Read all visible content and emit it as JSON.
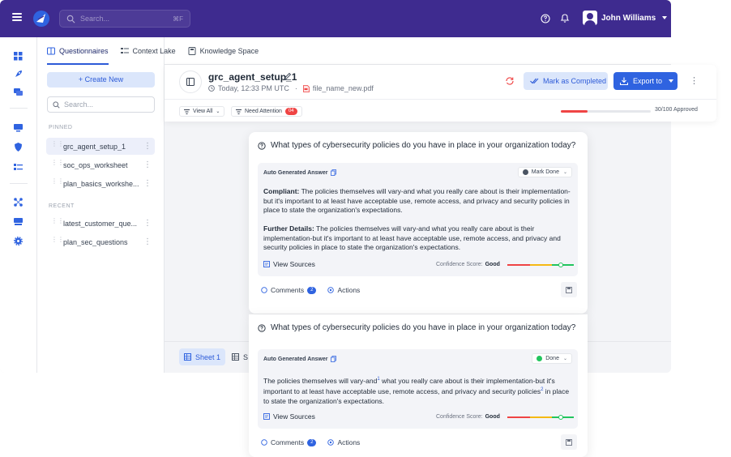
{
  "topbar": {
    "search_placeholder": "Search...",
    "search_shortcut": "⌘F",
    "user_name": "John Williams",
    "icons": [
      "menu-icon",
      "logo-icon",
      "search-icon",
      "help-icon",
      "bell-icon",
      "avatar",
      "chevron-down-icon"
    ]
  },
  "rail": {
    "icons": [
      "dashboard-icon",
      "rocket-icon",
      "chat-icon",
      "monitor-icon",
      "shield-icon",
      "list-icon",
      "nodes-icon",
      "display-icon",
      "gear-icon"
    ]
  },
  "sidebar": {
    "create_label": "+ Create New",
    "search_placeholder": "Search...",
    "pinned_label": "PINNED",
    "pinned": [
      {
        "label": "grc_agent_setup_1",
        "active": true
      },
      {
        "label": "soc_ops_worksheet",
        "active": false
      },
      {
        "label": "plan_basics_workshe...",
        "active": false
      }
    ],
    "recent_label": "RECENT",
    "recent": [
      {
        "label": "latest_customer_que..."
      },
      {
        "label": "plan_sec_questions"
      }
    ]
  },
  "tabs": [
    {
      "label": "Questionnaires",
      "active": true
    },
    {
      "label": "Context Lake",
      "active": false
    },
    {
      "label": "Knowledge Space",
      "active": false
    }
  ],
  "header": {
    "title": "grc_agent_setup_1",
    "timestamp": "Today, 12:33 PM UTC",
    "file": "file_name_new.pdf",
    "mark_label": "Mark as Completed",
    "export_label": "Export to",
    "view_all": "View All",
    "need_attention": "Need Attention",
    "need_attention_count": "04",
    "progress_fraction": 0.3,
    "progress_text": "30/100 Approved"
  },
  "sheets": [
    {
      "label": "Sheet 1",
      "active": true
    },
    {
      "label": "S",
      "active": false
    }
  ],
  "questions": [
    {
      "question": "What types of cybersecurity policies do you have in place in your organization today?",
      "answer_label": "Auto Generated Answer",
      "status": "Mark Done",
      "compliant_label": "Compliant:",
      "compliant_text": "The policies themselves will vary-and   what you really care about is their implementation-but it's important to at least have acceptable use, remote access, and privacy and security policies in place to state the organization's expectations.",
      "details_label": "Further Details:",
      "details_text": "The policies themselves will vary-and   what you really care about is their implementation-but it's important to at least have acceptable use, remote access, and privacy and security policies   in place to state the organization's expectations.",
      "view_sources": "View Sources",
      "confidence_label": "Confidence Score:",
      "confidence_value": "Good",
      "comments_label": "Comments",
      "comments_count": "2",
      "actions_label": "Actions"
    },
    {
      "question": "What types of cybersecurity policies do you have in place in your organization today?",
      "answer_label": "Auto Generated Answer",
      "status": "Done",
      "text_1": "The policies themselves will vary-and",
      "sup_1": "1",
      "text_2": " what you really care about is their implementation-but it's important to at least have acceptable use, remote access, and privacy and security policies",
      "sup_2": "2",
      "text_3": " in place to state the organization's expectations.",
      "view_sources": "View Sources",
      "confidence_label": "Confidence Score:",
      "confidence_value": "Good",
      "comments_label": "Comments",
      "comments_count": "2",
      "actions_label": "Actions"
    }
  ],
  "colors": {
    "topbar": "#3e2b8f",
    "accent": "#2f63e0",
    "alert": "#ef4444",
    "success": "#22c55e"
  }
}
